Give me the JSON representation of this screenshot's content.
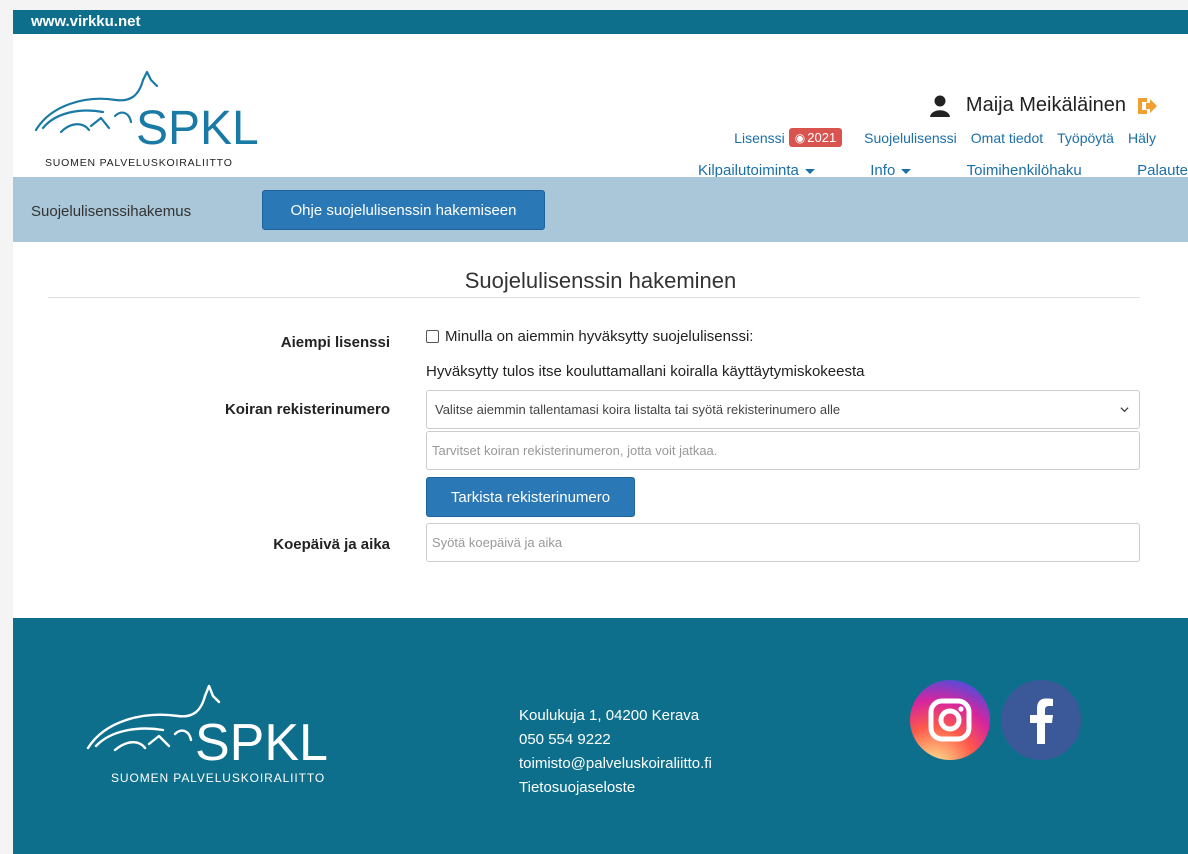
{
  "site_url": "www.virkku.net",
  "logo": {
    "wordmark": "SPKL",
    "subtitle": "SUOMEN PALVELUSKOIRALIITTO"
  },
  "user": {
    "name": "Maija Meikäläinen"
  },
  "nav_top": {
    "license_label": "Lisenssi",
    "license_badge": "2021",
    "items": [
      "Suojelulisenssi",
      "Omat tiedot",
      "Työpöytä",
      "Häly"
    ]
  },
  "nav_main": {
    "items": [
      "Kilpailutoiminta",
      "Info",
      "Toimihenkilöhaku",
      "Palaute"
    ]
  },
  "subbar": {
    "breadcrumb": "Suojelulisenssihakemus",
    "help_button": "Ohje suojelulisenssin hakemiseen"
  },
  "form": {
    "title": "Suojelulisenssin hakeminen",
    "prev_license_label": "Aiempi lisenssi",
    "prev_license_checkbox": "Minulla on aiemmin hyväksytty suojelulisenssi:",
    "help_text": "Hyväksytty tulos itse kouluttamallani koiralla käyttäytymiskokeesta",
    "reg_label": "Koiran rekisterinumero",
    "reg_select": "Valitse aiemmin tallentamasi koira listalta tai syötä rekisterinumero alle",
    "reg_placeholder": "Tarvitset koiran rekisterinumeron, jotta voit jatkaa.",
    "check_button": "Tarkista rekisterinumero",
    "date_label": "Koepäivä ja aika",
    "date_placeholder": "Syötä koepäivä ja aika"
  },
  "footer": {
    "address": "Koulukuja 1, 04200 Kerava",
    "phone": "050 554 9222",
    "email": "toimisto@palveluskoiraliitto.fi",
    "privacy": "Tietosuojaseloste"
  },
  "colors": {
    "brand_teal": "#0e6f8c",
    "subbar": "#a9c7d8",
    "button": "#2b78b7",
    "link": "#1b6fa8",
    "badge": "#d9534f",
    "logout": "#f0a030"
  }
}
